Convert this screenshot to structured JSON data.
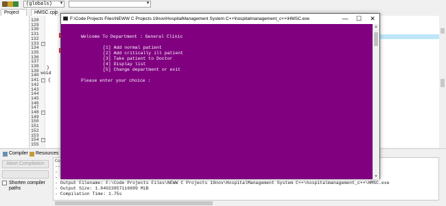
{
  "ide": {
    "scope_select": "(globals)",
    "function_select": "",
    "tabs": {
      "project": "Project",
      "file": "HMSC.cpp"
    },
    "line_numbers": [
      "128",
      "129",
      "130",
      "131",
      "132",
      "133",
      "134",
      "135",
      "136",
      "137",
      "138",
      "139",
      "140",
      "141",
      "142",
      "143",
      "144",
      "145",
      "146",
      "147",
      "148",
      "149",
      "150",
      "151",
      "152",
      "153",
      "154",
      "155"
    ],
    "code_fragments": {
      "close_brace": "}",
      "void_kw": "void",
      "open_brace": "{"
    },
    "bottom_tabs": {
      "compiler": "Compiler",
      "resources": "Resources"
    },
    "buttons": {
      "abort": "Abort Compilation"
    },
    "shorten_paths": "Shorten compiler paths",
    "log_header": "Co",
    "log_lines": [
      "--",
      "- ",
      "- ",
      "- Output Filename: F:\\Code Projects Files\\NEWW C Projects 19nov\\HospitalManagement System C++\\hospitalmanagement_c++\\HMSC.exe",
      "- Output Size: 1.84023857116699 MiB",
      "- Compilation Time: 1.75s"
    ]
  },
  "console": {
    "title": "F:\\Code Projects Files\\NEWW C Projects 19nov\\HospitalManagement System C++\\hospitalmanagement_c++\\HMSC.exe",
    "buttons": {
      "minimize": "—",
      "maximize": "☐",
      "close": "✕"
    },
    "welcome": "Welcome To Department : General Clinic",
    "menu": [
      "[1] Add normal patient",
      "[2] Add critically ill patient",
      "[3] Take patient to Doctor",
      "[4] Display list",
      "[5] Change department or exit"
    ],
    "prompt": "Please enter your choice :"
  },
  "colors": {
    "console_bg": "#800080",
    "highlight_line": "#bfe6f8",
    "breakpoint": "#e03030"
  }
}
